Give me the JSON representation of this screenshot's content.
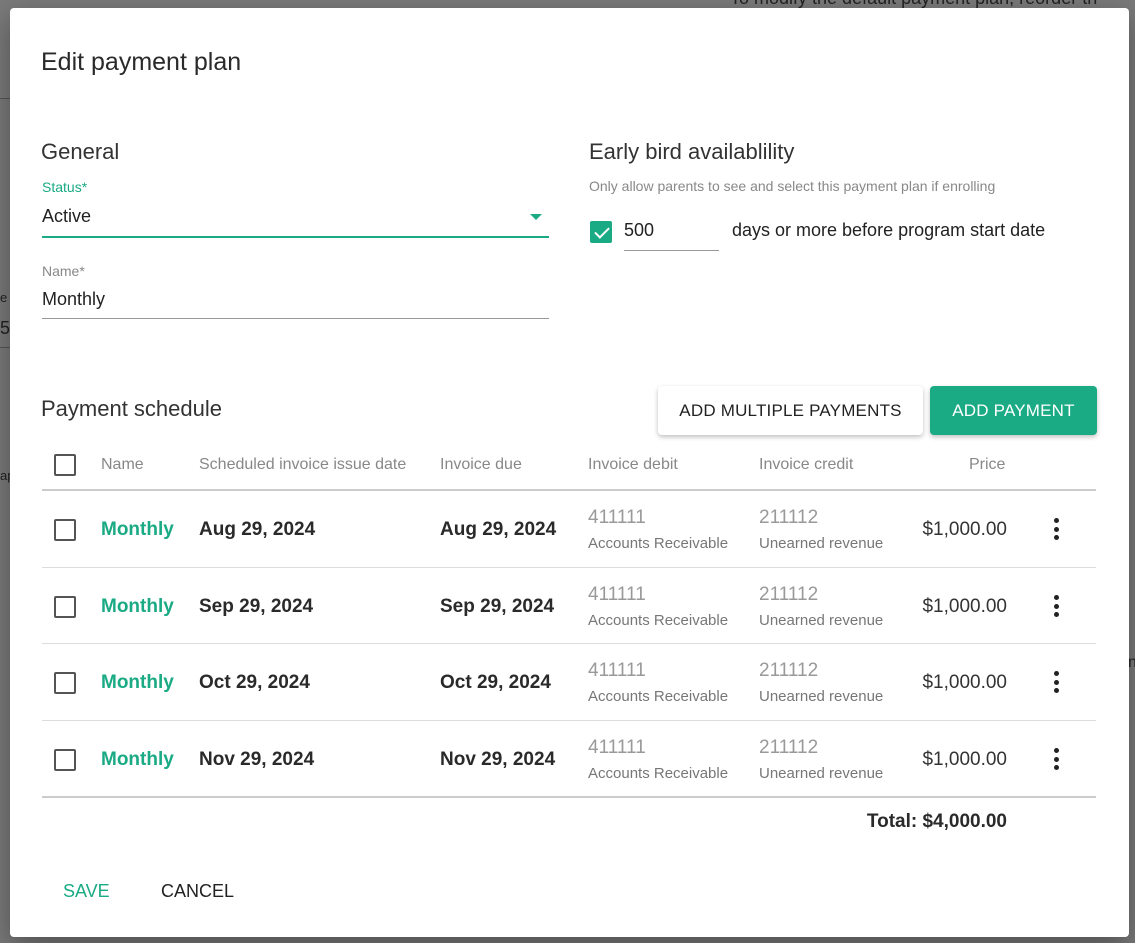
{
  "background": {
    "top_text": "To modify the default payment plan, reorder th",
    "left_frag_1": "e",
    "left_frag_2": "5",
    "left_frag_3": "ap",
    "right_frag": "n"
  },
  "dialog": {
    "title": "Edit payment plan"
  },
  "general": {
    "section_title": "General",
    "status_label": "Status*",
    "status_value": "Active",
    "name_label": "Name*",
    "name_value": "Monthly"
  },
  "early_bird": {
    "section_title": "Early bird availablility",
    "hint": "Only allow parents to see and select this payment plan if enrolling",
    "enabled": true,
    "days_value": "500",
    "suffix": "days or more before program start date"
  },
  "schedule": {
    "title": "Payment schedule",
    "add_multiple_label": "ADD MULTIPLE PAYMENTS",
    "add_payment_label": "ADD PAYMENT",
    "columns": {
      "name": "Name",
      "issue_date": "Scheduled invoice issue date",
      "due": "Invoice due",
      "debit": "Invoice debit",
      "credit": "Invoice credit",
      "price": "Price"
    },
    "rows": [
      {
        "name": "Monthly",
        "issue_date": "Aug 29, 2024",
        "due": "Aug 29, 2024",
        "debit_code": "411111",
        "debit_name": "Accounts Receivable",
        "credit_code": "211112",
        "credit_name": "Unearned revenue",
        "price": "$1,000.00"
      },
      {
        "name": "Monthly",
        "issue_date": "Sep 29, 2024",
        "due": "Sep 29, 2024",
        "debit_code": "411111",
        "debit_name": "Accounts Receivable",
        "credit_code": "211112",
        "credit_name": "Unearned revenue",
        "price": "$1,000.00"
      },
      {
        "name": "Monthly",
        "issue_date": "Oct 29, 2024",
        "due": "Oct 29, 2024",
        "debit_code": "411111",
        "debit_name": "Accounts Receivable",
        "credit_code": "211112",
        "credit_name": "Unearned revenue",
        "price": "$1,000.00"
      },
      {
        "name": "Monthly",
        "issue_date": "Nov 29, 2024",
        "due": "Nov 29, 2024",
        "debit_code": "411111",
        "debit_name": "Accounts Receivable",
        "credit_code": "211112",
        "credit_name": "Unearned revenue",
        "price": "$1,000.00"
      }
    ],
    "total": "Total: $4,000.00"
  },
  "actions": {
    "save_label": "SAVE",
    "cancel_label": "CANCEL"
  },
  "colors": {
    "accent": "#1aaa84",
    "overlay": "#6f6f6f"
  }
}
